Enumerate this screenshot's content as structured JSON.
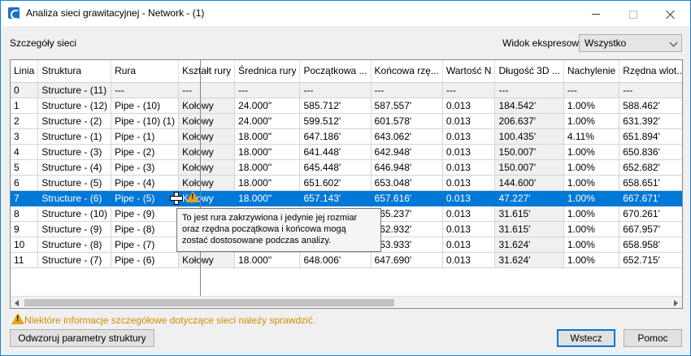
{
  "window": {
    "title": "Analiza sieci grawitacyjnej - Network - (1)"
  },
  "header": {
    "section_label": "Szczegóły sieci",
    "view_label": "Widok ekspresowy",
    "view_value": "Wszystko"
  },
  "table": {
    "columns": [
      "Linia",
      "Struktura",
      "Rura",
      "Kształt rury",
      "Średnica rury",
      "Początkowa ...",
      "Końcowa rzę...",
      "Wartość N",
      "Długość 3D ...",
      "Nachylenie",
      "Rzędna wlot..."
    ],
    "rows": [
      [
        "0",
        "Structure - (11)",
        "---",
        "---",
        "---",
        "---",
        "---",
        "---",
        "---",
        "---",
        "---"
      ],
      [
        "1",
        "Structure - (12)",
        "Pipe - (10)",
        "Kołowy",
        "24.000\"",
        "585.712'",
        "587.557'",
        "0.013",
        "184.542'",
        "1.00%",
        "588.462'"
      ],
      [
        "2",
        "Structure - (2)",
        "Pipe - (10) (1)",
        "Kołowy",
        "24.000\"",
        "599.512'",
        "601.578'",
        "0.013",
        "206.637'",
        "1.00%",
        "631.392'"
      ],
      [
        "3",
        "Structure - (1)",
        "Pipe - (1)",
        "Kołowy",
        "18.000\"",
        "647.186'",
        "643.062'",
        "0.013",
        "100.435'",
        "4.11%",
        "651.894'"
      ],
      [
        "4",
        "Structure - (3)",
        "Pipe - (2)",
        "Kołowy",
        "18.000\"",
        "641.448'",
        "642.948'",
        "0.013",
        "150.007'",
        "1.00%",
        "650.836'"
      ],
      [
        "5",
        "Structure - (4)",
        "Pipe - (3)",
        "Kołowy",
        "18.000\"",
        "645.448'",
        "646.948'",
        "0.013",
        "150.007'",
        "1.00%",
        "652.682'"
      ],
      [
        "6",
        "Structure - (5)",
        "Pipe - (4)",
        "Kołowy",
        "18.000\"",
        "651.602'",
        "653.048'",
        "0.013",
        "144.600'",
        "1.00%",
        "658.651'"
      ],
      [
        "7",
        "Structure - (6)",
        "Pipe - (5)",
        "Kołowy",
        "18.000\"",
        "657.143'",
        "657.616'",
        "0.013",
        "47.227'",
        "1.00%",
        "667.671'"
      ],
      [
        "8",
        "Structure - (10)",
        "Pipe - (9)",
        "",
        "",
        "",
        "665.237'",
        "0.013",
        "31.615'",
        "1.00%",
        "670.261'"
      ],
      [
        "9",
        "Structure - (9)",
        "Pipe - (8)",
        "",
        "",
        "",
        "662.932'",
        "0.013",
        "31.615'",
        "1.00%",
        "667.957'"
      ],
      [
        "10",
        "Structure - (8)",
        "Pipe - (7)",
        "",
        "",
        "",
        "653.933'",
        "0.013",
        "31.624'",
        "1.00%",
        "658.958'"
      ],
      [
        "11",
        "Structure - (7)",
        "Pipe - (6)",
        "Kołowy",
        "18.000\"",
        "648.006'",
        "647.690'",
        "0.013",
        "31.624'",
        "1.00%",
        "652.715'"
      ]
    ],
    "selected_row": 7
  },
  "tooltip": {
    "line1": "To jest rura zakrzywiona i jedynie jej rozmiar",
    "line2": "oraz rzędna początkowa i końcowa mogą",
    "line3": "zostać dostosowane podczas analizy."
  },
  "status": {
    "warning_text": "Niektóre informacje szczegółowe dotyczące sieci należy sprawdzić."
  },
  "buttons": {
    "reset": "Odwzoruj parametry struktury",
    "ok": "Wstecz",
    "help": "Pomoc"
  },
  "colors": {
    "selection": "#0078d7",
    "warning": "#e8a317",
    "warning_text": "#d68a00"
  }
}
